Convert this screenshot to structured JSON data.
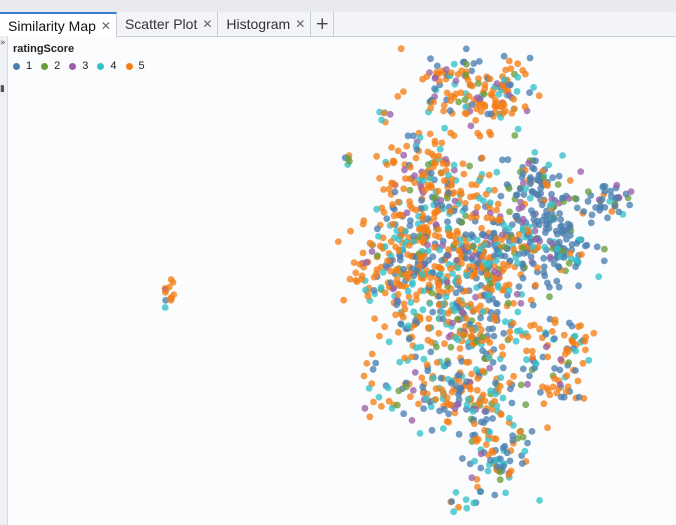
{
  "tabs": [
    {
      "label": "Similarity Map",
      "active": true
    },
    {
      "label": "Scatter Plot",
      "active": false
    },
    {
      "label": "Histogram",
      "active": false
    }
  ],
  "add_tab_icon": "plus-icon",
  "close_icon": "close-icon",
  "legend": {
    "title": "ratingScore",
    "items": [
      {
        "label": "1",
        "color": "#4c7fb0"
      },
      {
        "label": "2",
        "color": "#6a9e3c"
      },
      {
        "label": "3",
        "color": "#9a5fa6"
      },
      {
        "label": "4",
        "color": "#33c1c8"
      },
      {
        "label": "5",
        "color": "#f57f17"
      }
    ]
  },
  "chart_data": {
    "type": "scatter",
    "title": "",
    "xlabel": "",
    "ylabel": "",
    "grid": false,
    "legend_placement": "top-left",
    "color_by": "ratingScore",
    "categories": [
      "1",
      "2",
      "3",
      "4",
      "5"
    ]
  }
}
